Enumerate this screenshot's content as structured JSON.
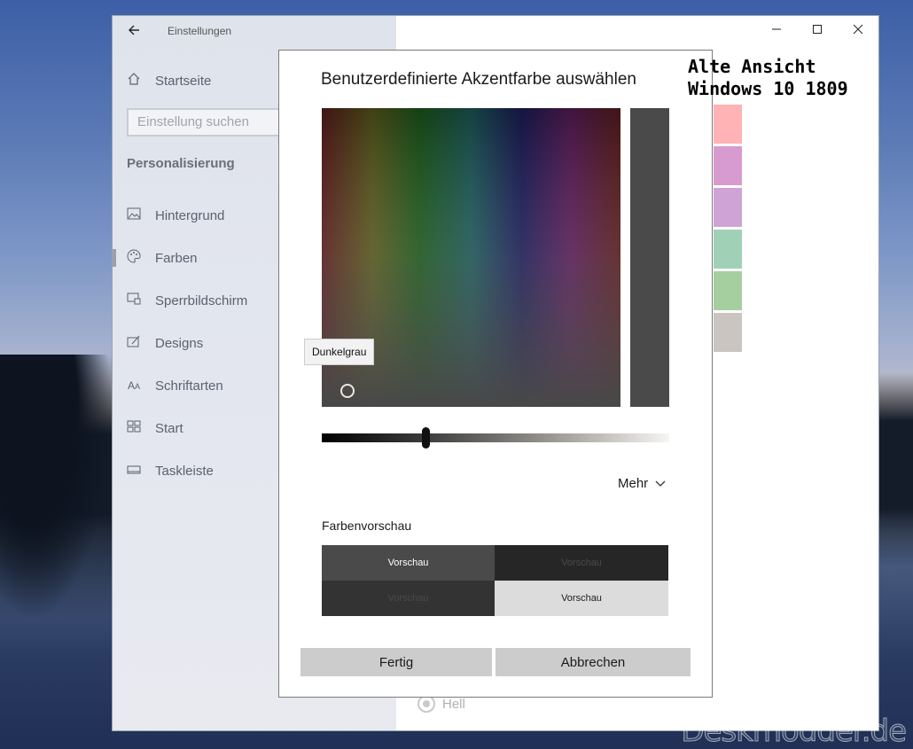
{
  "window": {
    "back_icon": "back-arrow-icon",
    "title": "Einstellungen",
    "caption": {
      "minimize": "—",
      "maximize": "☐",
      "close": "✕"
    }
  },
  "sidebar": {
    "home_label": "Startseite",
    "search_placeholder": "Einstellung suchen",
    "section": "Personalisierung",
    "items": [
      {
        "label": "Hintergrund",
        "icon": "picture-icon"
      },
      {
        "label": "Farben",
        "icon": "palette-icon",
        "active": true
      },
      {
        "label": "Sperrbildschirm",
        "icon": "lockscreen-icon"
      },
      {
        "label": "Designs",
        "icon": "designs-icon"
      },
      {
        "label": "Schriftarten",
        "icon": "font-icon"
      },
      {
        "label": "Start",
        "icon": "start-icon"
      },
      {
        "label": "Taskleiste",
        "icon": "taskbar-icon"
      }
    ]
  },
  "annotation": {
    "line1": "Alte Ansicht",
    "line2": "Windows 10 1809"
  },
  "background_swatches": [
    "#ffb3b5",
    "#d89bd0",
    "#cfa3d6",
    "#a0d0b6",
    "#a6cfa0",
    "#cac5c0"
  ],
  "radio": {
    "label": "Hell"
  },
  "dialog": {
    "title": "Benutzerdefinierte Akzentfarbe auswählen",
    "tooltip": "Dunkelgrau",
    "selected_color": "#4a4a4a",
    "brightness_fraction": 0.3,
    "more_label": "Mehr",
    "preview_section_label": "Farbenvorschau",
    "previews": [
      "Vorschau",
      "Vorschau",
      "Vorschau",
      "Vorschau"
    ],
    "ok_label": "Fertig",
    "cancel_label": "Abbrechen"
  },
  "watermark": "Deskmodder.de"
}
